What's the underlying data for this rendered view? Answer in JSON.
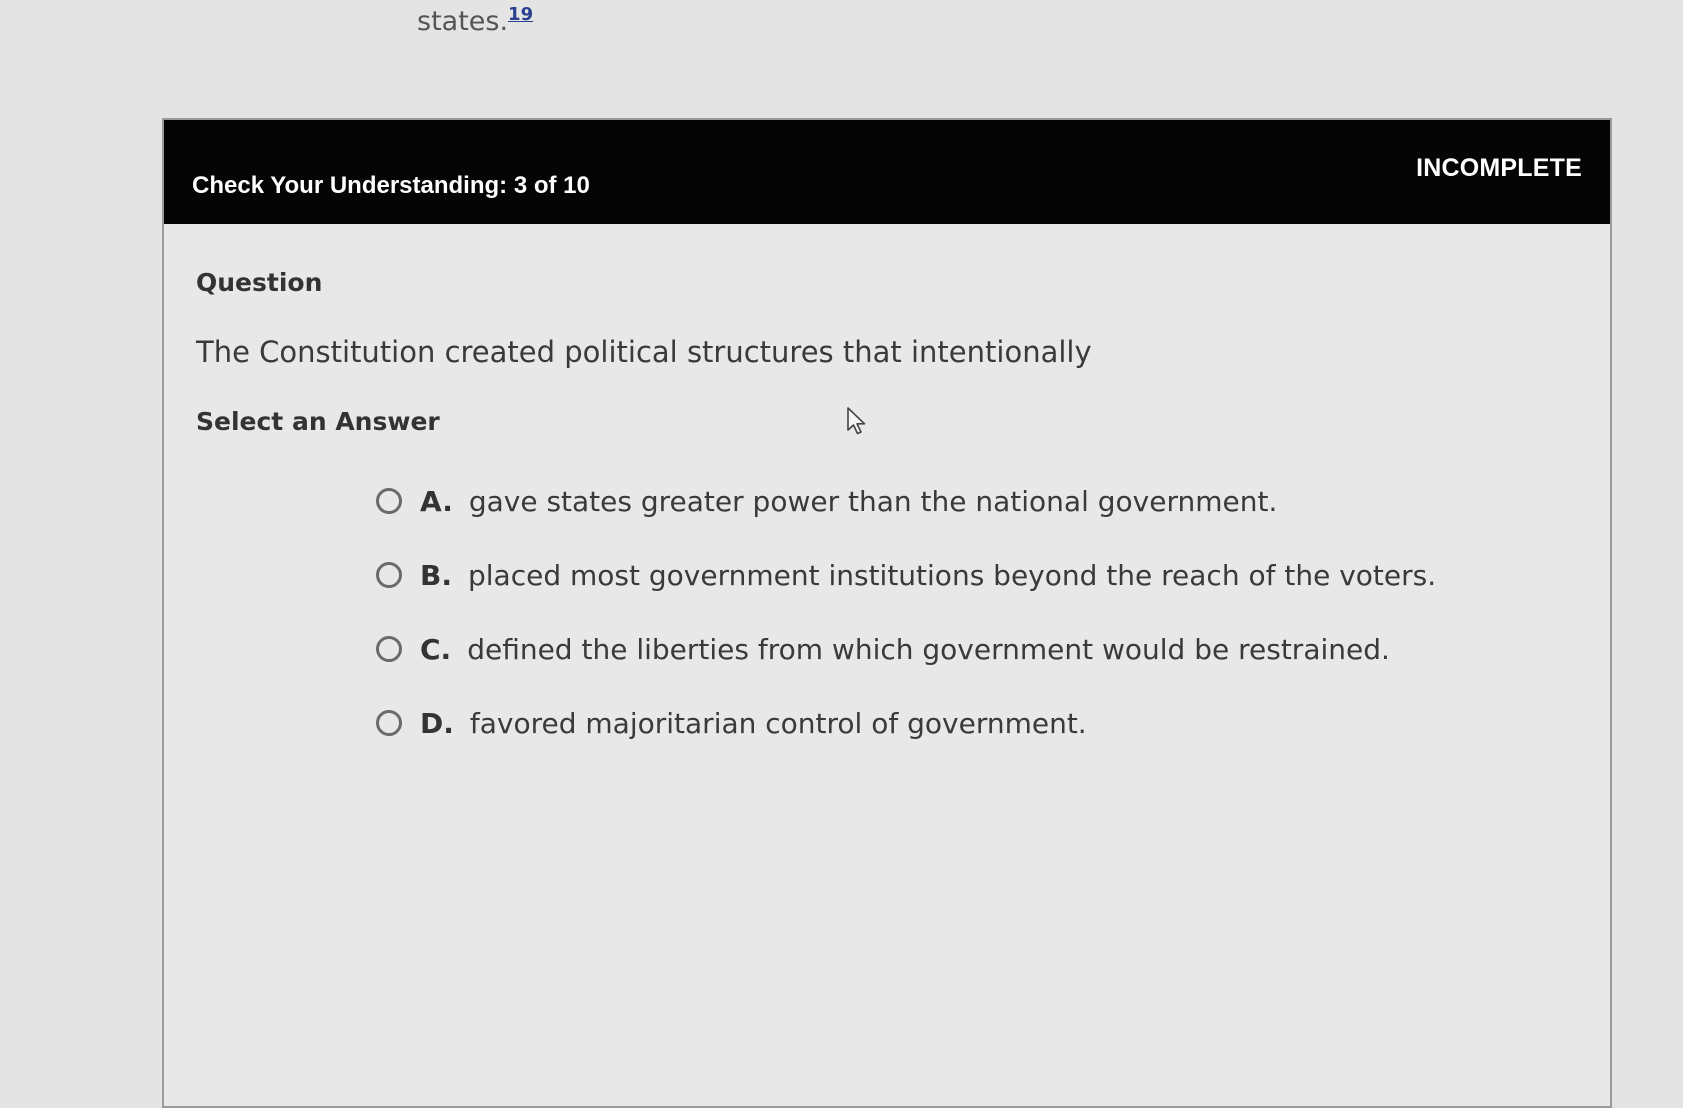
{
  "top_fragment": {
    "text": "states.",
    "footnote": "19"
  },
  "header": {
    "title": "Check Your Understanding: 3 of 10",
    "status": "INCOMPLETE"
  },
  "question": {
    "label": "Question",
    "text": "The Constitution created political structures that intentionally"
  },
  "answers": {
    "label": "Select an Answer",
    "options": [
      {
        "letter": "A.",
        "text": "gave states greater power than the national government."
      },
      {
        "letter": "B.",
        "text": "placed most government institutions beyond the reach of the voters."
      },
      {
        "letter": "C.",
        "text": "defined the liberties from which government would be restrained."
      },
      {
        "letter": "D.",
        "text": "favored majoritarian control of government."
      }
    ]
  },
  "icons": {
    "radio": "radio-unselected-icon",
    "cursor": "mouse-pointer-icon"
  },
  "colors": {
    "header_bg": "#050505",
    "header_text": "#ffffff",
    "footnote_link": "#2a3f8f"
  }
}
